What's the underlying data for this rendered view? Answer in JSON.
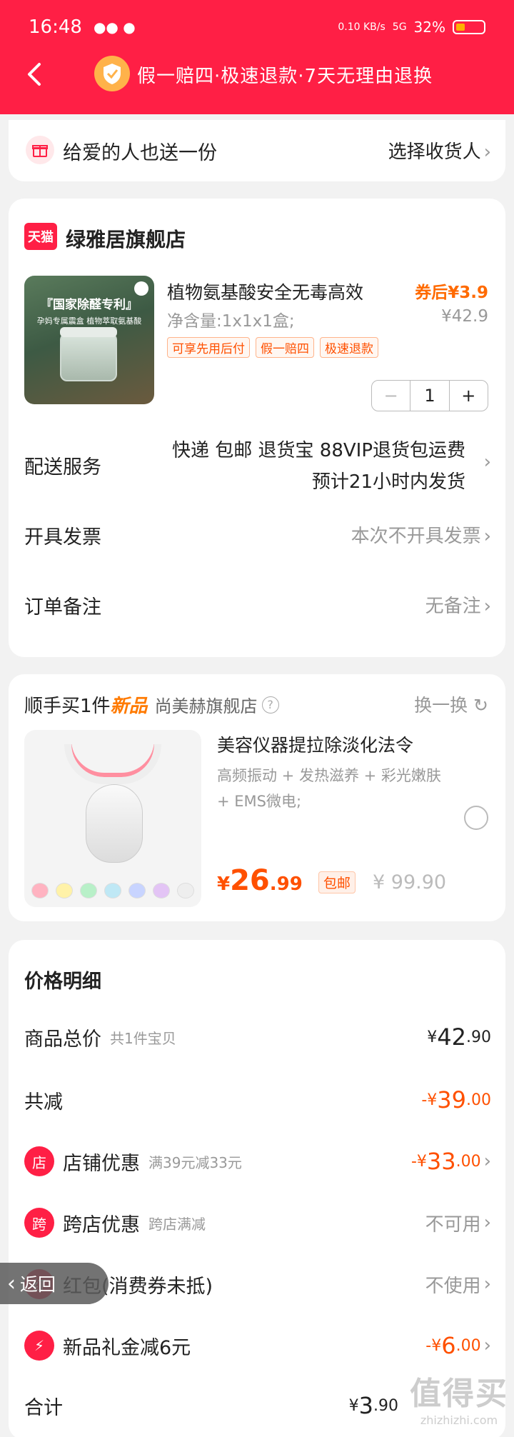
{
  "status": {
    "time": "16:48",
    "net_speed": "0.10 KB/s",
    "signal": "5G",
    "battery": "32%",
    "battery_level": 0.32
  },
  "nav": {
    "guarantee": "假一赔四·极速退款·7天无理由退换"
  },
  "gift": {
    "label": "给爱的人也送一份",
    "action": "选择收货人"
  },
  "store": {
    "badge": "天猫",
    "name": "绿雅居旗舰店",
    "product": {
      "image_banner": "『国家除醛专利』",
      "image_sub": "孕妈专属震盒 植物萃取氨基酸",
      "title": "植物氨基酸安全无毒高效",
      "spec": "净含量:1x1x1盒;",
      "price_label": "券后¥3.9",
      "original_price": "¥42.9",
      "tags": [
        "可享先用后付",
        "假一赔四",
        "极速退款"
      ],
      "quantity": "1"
    },
    "shipping": {
      "label": "配送服务",
      "line1": "快递 包邮 退货宝 88VIP退货包运费",
      "line2": "预计21小时内发货"
    },
    "invoice": {
      "label": "开具发票",
      "value": "本次不开具发票"
    },
    "note": {
      "label": "订单备注",
      "value": "无备注"
    }
  },
  "recommend": {
    "prefix": "顺手买1件",
    "highlight": "新品",
    "store": "尚美赫旗舰店",
    "swap": "换一换",
    "title": "美容仪器提拉除淡化法令",
    "desc": "高频振动 + 发热滋养 + 彩光嫩肤 + EMS微电;",
    "price_symbol": "¥",
    "price_int": "26",
    "price_dec": ".99",
    "badge": "包邮",
    "original": "¥ 99.90"
  },
  "price_detail": {
    "title": "价格明细",
    "rows": [
      {
        "label": "商品总价",
        "sub": "共1件宝贝",
        "val_prefix": "¥",
        "val_int": "42",
        "val_dec": ".90"
      },
      {
        "label": "共减",
        "val_prefix": "-¥",
        "val_int": "39",
        "val_dec": ".00"
      },
      {
        "icon": "店",
        "label": "店铺优惠",
        "sub": "满39元减33元",
        "val_prefix": "-¥",
        "val_int": "33",
        "val_dec": ".00"
      },
      {
        "icon": "跨",
        "label": "跨店优惠",
        "sub": "跨店满减",
        "value": "不可用"
      },
      {
        "icon": "红",
        "label": "红包(消费券未抵)",
        "value": "不使用"
      },
      {
        "icon": "⚡",
        "label": "新品礼金减6元",
        "val_prefix": "-¥",
        "val_int": "6",
        "val_dec": ".00"
      },
      {
        "label": "合计",
        "val_prefix": "¥",
        "val_int": "3",
        "val_dec": ".90"
      }
    ]
  },
  "floating_back": "返回",
  "watermark": {
    "main": "值得买",
    "sub": "zhizhizhi.com"
  }
}
